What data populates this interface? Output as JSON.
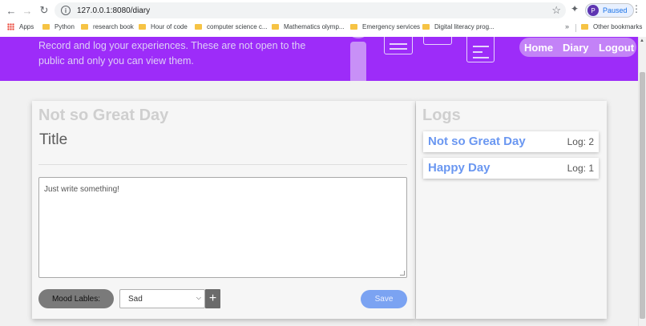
{
  "browser": {
    "url": "127.0.0.1:8080/diary",
    "profile_initial": "P",
    "profile_status": "Paused",
    "bookmarks": [
      "Apps",
      "Python",
      "research book",
      "Hour of code",
      "computer science c...",
      "Mathematics olymp...",
      "Emergency services",
      "Digital literacy prog..."
    ],
    "overflow": "»",
    "other_bookmarks": "Other bookmarks"
  },
  "hero": {
    "description": "Record and log your experiences. These are not open to the public and only you can view them."
  },
  "nav": {
    "items": [
      "Home",
      "Diary",
      "Logout"
    ]
  },
  "entry": {
    "heading": "Not so Great Day",
    "title_placeholder": "Title",
    "body_placeholder": "Just write something!",
    "mood_label": "Mood Lables:",
    "mood_selected": "Sad",
    "add_symbol": "+",
    "save_label": "Save"
  },
  "logs": {
    "heading": "Logs",
    "items": [
      {
        "name": "Not so Great Day",
        "log": "Log: 2"
      },
      {
        "name": "Happy Day",
        "log": "Log: 1"
      }
    ]
  },
  "colors": {
    "hero": "#9d2cf9",
    "accent_blue": "#6a97f1",
    "save": "#7ba3f2"
  }
}
